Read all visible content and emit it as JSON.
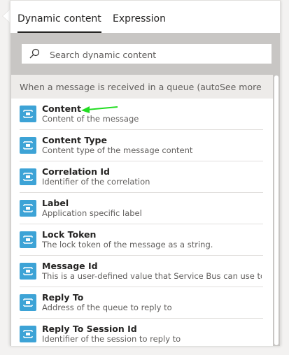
{
  "tabs": [
    {
      "label": "Dynamic content",
      "active": true
    },
    {
      "label": "Expression",
      "active": false
    }
  ],
  "search": {
    "placeholder": "Search dynamic content",
    "value": ""
  },
  "trigger": {
    "text": "When a message is received in a queue (auto-...",
    "see_more": "See more"
  },
  "items": [
    {
      "title": "Content",
      "description": "Content of the message"
    },
    {
      "title": "Content Type",
      "description": "Content type of the message content"
    },
    {
      "title": "Correlation Id",
      "description": "Identifier of the correlation"
    },
    {
      "title": "Label",
      "description": "Application specific label"
    },
    {
      "title": "Lock Token",
      "description": "The lock token of the message as a string."
    },
    {
      "title": "Message Id",
      "description": "This is a user-defined value that Service Bus can use to i..."
    },
    {
      "title": "Reply To",
      "description": "Address of the queue to reply to"
    },
    {
      "title": "Reply To Session Id",
      "description": "Identifier of the session to reply to"
    }
  ],
  "colors": {
    "item_icon": "#3da3d6",
    "annotation_arrow": "#22dd22"
  },
  "icons": {
    "search": "search-icon",
    "item": "service-bus-message-icon",
    "annotation": "green-arrow-icon"
  }
}
